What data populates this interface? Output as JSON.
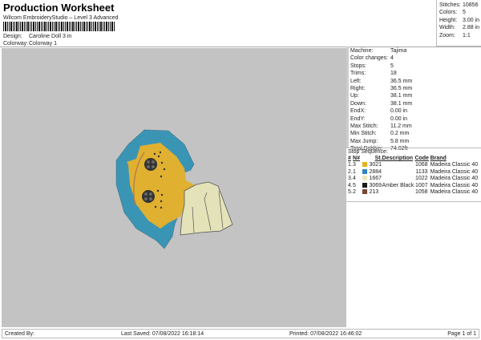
{
  "header": {
    "title": "Production Worksheet",
    "subtitle": "Wilcom EmbroideryStudio – Level 3 Advanced",
    "design": [
      {
        "k": "Design:",
        "v": "Caroline Doll 3 in"
      },
      {
        "k": "Colorway:",
        "v": "Colorway 1"
      }
    ]
  },
  "stats": [
    {
      "k": "Stitches:",
      "v": "10856"
    },
    {
      "k": "Colors:",
      "v": "5"
    },
    {
      "k": "Height:",
      "v": "3.00 in"
    },
    {
      "k": "Width:",
      "v": "2.88 in"
    },
    {
      "k": "Zoom:",
      "v": "1:1"
    }
  ],
  "machine": [
    {
      "k": "Machine:",
      "v": "Tajima"
    },
    {
      "k": "Color changes:",
      "v": "4"
    },
    {
      "k": "Stops:",
      "v": "5"
    },
    {
      "k": "Trims:",
      "v": "18"
    },
    {
      "k": "Left:",
      "v": "36.5 mm"
    },
    {
      "k": "Right:",
      "v": "36.5 mm"
    },
    {
      "k": "Up:",
      "v": "38.1 mm"
    },
    {
      "k": "Down:",
      "v": "38.1 mm"
    },
    {
      "k": "EndX:",
      "v": "0.00 in"
    },
    {
      "k": "EndY:",
      "v": "0.00 in"
    },
    {
      "k": "Max Stitch:",
      "v": "11.2 mm"
    },
    {
      "k": "Min Stitch:",
      "v": "0.2 mm"
    },
    {
      "k": "Max Jump:",
      "v": "5.8 mm"
    },
    {
      "k": "Total Bobbin:",
      "v": "74.02ft"
    }
  ],
  "stop_sequence": {
    "label": "Stop Sequence:",
    "headers": [
      "#",
      "N#",
      "St.",
      "Description",
      "Code",
      "Brand"
    ],
    "rows": [
      {
        "n": "1.",
        "nn": "3",
        "color": "#e8b020",
        "st": "3021",
        "desc": "",
        "code": "1068",
        "brand": "Madeira Classic 40"
      },
      {
        "n": "2.",
        "nn": "1",
        "color": "#2f86c0",
        "st": "2884",
        "desc": "",
        "code": "1133",
        "brand": "Madeira Classic 40"
      },
      {
        "n": "3.",
        "nn": "4",
        "color": "#ece8c0",
        "st": "1667",
        "desc": "",
        "code": "1022",
        "brand": "Madeira Classic 40"
      },
      {
        "n": "4.",
        "nn": "5",
        "color": "#1a1a1a",
        "st": "3069",
        "desc": "Amber Black",
        "code": "1007",
        "brand": "Madeira Classic 40"
      },
      {
        "n": "5.",
        "nn": "2",
        "color": "#7a4535",
        "st": "213",
        "desc": "",
        "code": "1058",
        "brand": "Madeira Classic 40"
      }
    ]
  },
  "footer": {
    "created": "Created By:",
    "saved": "Last Saved: 07/08/2022 16:18:14",
    "printed": "Printed: 07/08/2022 16:46:02",
    "page": "Page 1 of 1"
  },
  "colors": {
    "canvas": "#c3c3c3",
    "blue": "#3a95b5",
    "yellow": "#e0b030",
    "cream": "#e4e2b8"
  }
}
